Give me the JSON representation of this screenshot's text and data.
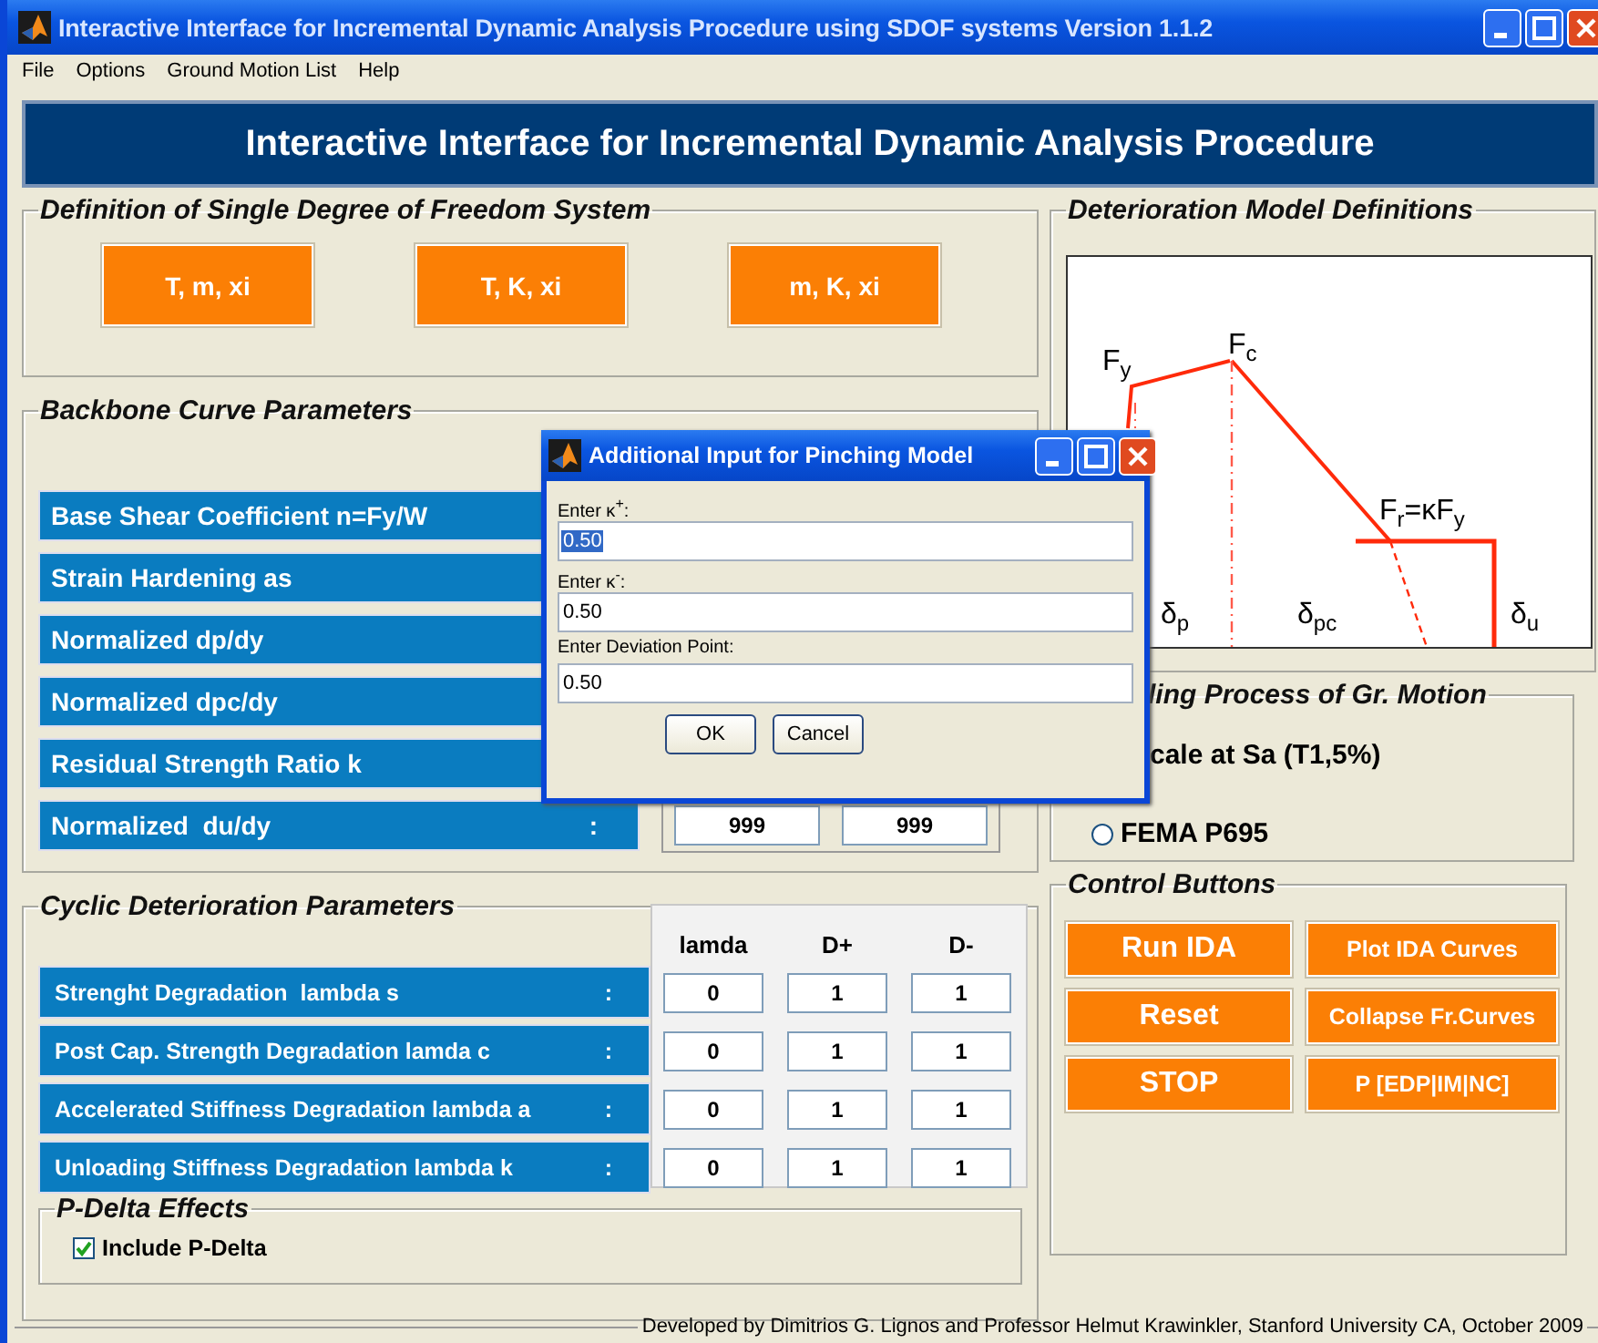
{
  "window": {
    "title": "Interactive Interface for Incremental Dynamic Analysis Procedure using SDOF systems Version 1.1.2"
  },
  "menu": [
    "File",
    "Options",
    "Ground Motion List",
    "Help"
  ],
  "banner": "Interactive Interface for Incremental Dynamic Analysis Procedure",
  "sdof_panel": {
    "title": "Definition of Single Degree of Freedom System",
    "buttons": [
      "T, m, xi",
      "T, K, xi",
      "m, K, xi"
    ]
  },
  "backbone_panel": {
    "title": "Backbone Curve Parameters",
    "rows": [
      {
        "label": "Base Shear Coefficient n=Fy/W"
      },
      {
        "label": "Strain Hardening as"
      },
      {
        "label": "Normalized dp/dy"
      },
      {
        "label": "Normalized dpc/dy"
      },
      {
        "label": "Residual Strength Ratio k"
      },
      {
        "label": "Normalized  du/dy",
        "colon": ":",
        "values": [
          "999",
          "999"
        ]
      }
    ]
  },
  "deterioration_panel": {
    "title": "Deterioration Model Definitions",
    "diagram_labels": [
      "F$_{y}$",
      "F$_{c}$",
      "F$_{r}$=κF$_{y}$",
      "δ$_{p}$",
      "δ$_{pc}$",
      "δ$_{u}$"
    ]
  },
  "scaling_panel": {
    "title": "ling Process of Gr. Motion",
    "options": [
      {
        "label": "cale at Sa (T1,5%)"
      },
      {
        "label": "FEMA P695",
        "selected": false
      }
    ]
  },
  "cyclic_panel": {
    "title": "Cyclic Deterioration Parameters",
    "columns": [
      "lamda",
      "D+",
      "D-"
    ],
    "rows": [
      {
        "label": "Strenght Degradation  lambda s",
        "colon": ":",
        "values": [
          "0",
          "1",
          "1"
        ]
      },
      {
        "label": "Post Cap. Strength Degradation lamda c",
        "colon": ":",
        "values": [
          "0",
          "1",
          "1"
        ]
      },
      {
        "label": "Accelerated Stiffness Degradation lambda a",
        "colon": ":",
        "values": [
          "0",
          "1",
          "1"
        ]
      },
      {
        "label": "Unloading Stiffness Degradation lambda k",
        "colon": ":",
        "values": [
          "0",
          "1",
          "1"
        ]
      }
    ]
  },
  "pdelta_panel": {
    "title": "P-Delta Effects",
    "checkbox": {
      "label": "Include P-Delta",
      "checked": true
    }
  },
  "control_panel": {
    "title": "Control Buttons",
    "buttons": [
      {
        "label": "Run IDA",
        "kind": "large"
      },
      {
        "label": "Plot IDA Curves",
        "kind": "small"
      },
      {
        "label": "Reset",
        "kind": "large"
      },
      {
        "label": "Collapse Fr.Curves",
        "kind": "small"
      },
      {
        "label": "STOP",
        "kind": "large"
      },
      {
        "label": "P [EDP|IM|NC]",
        "kind": "small"
      }
    ]
  },
  "footer": "Developed by Dimitrios G. Lignos and Professor Helmut Krawinkler, Stanford University CA, October 2009",
  "dialog": {
    "title": "Additional Input for Pinching Model",
    "fields": [
      {
        "label": "Enter κ$^{+}$:",
        "value": "0.50",
        "selected": true
      },
      {
        "label": "Enter κ$^{-}$:",
        "value": "0.50",
        "selected": false
      },
      {
        "label": "Enter Deviation Point:",
        "value": "0.50",
        "selected": false
      }
    ],
    "buttons": [
      "OK",
      "Cancel"
    ]
  }
}
